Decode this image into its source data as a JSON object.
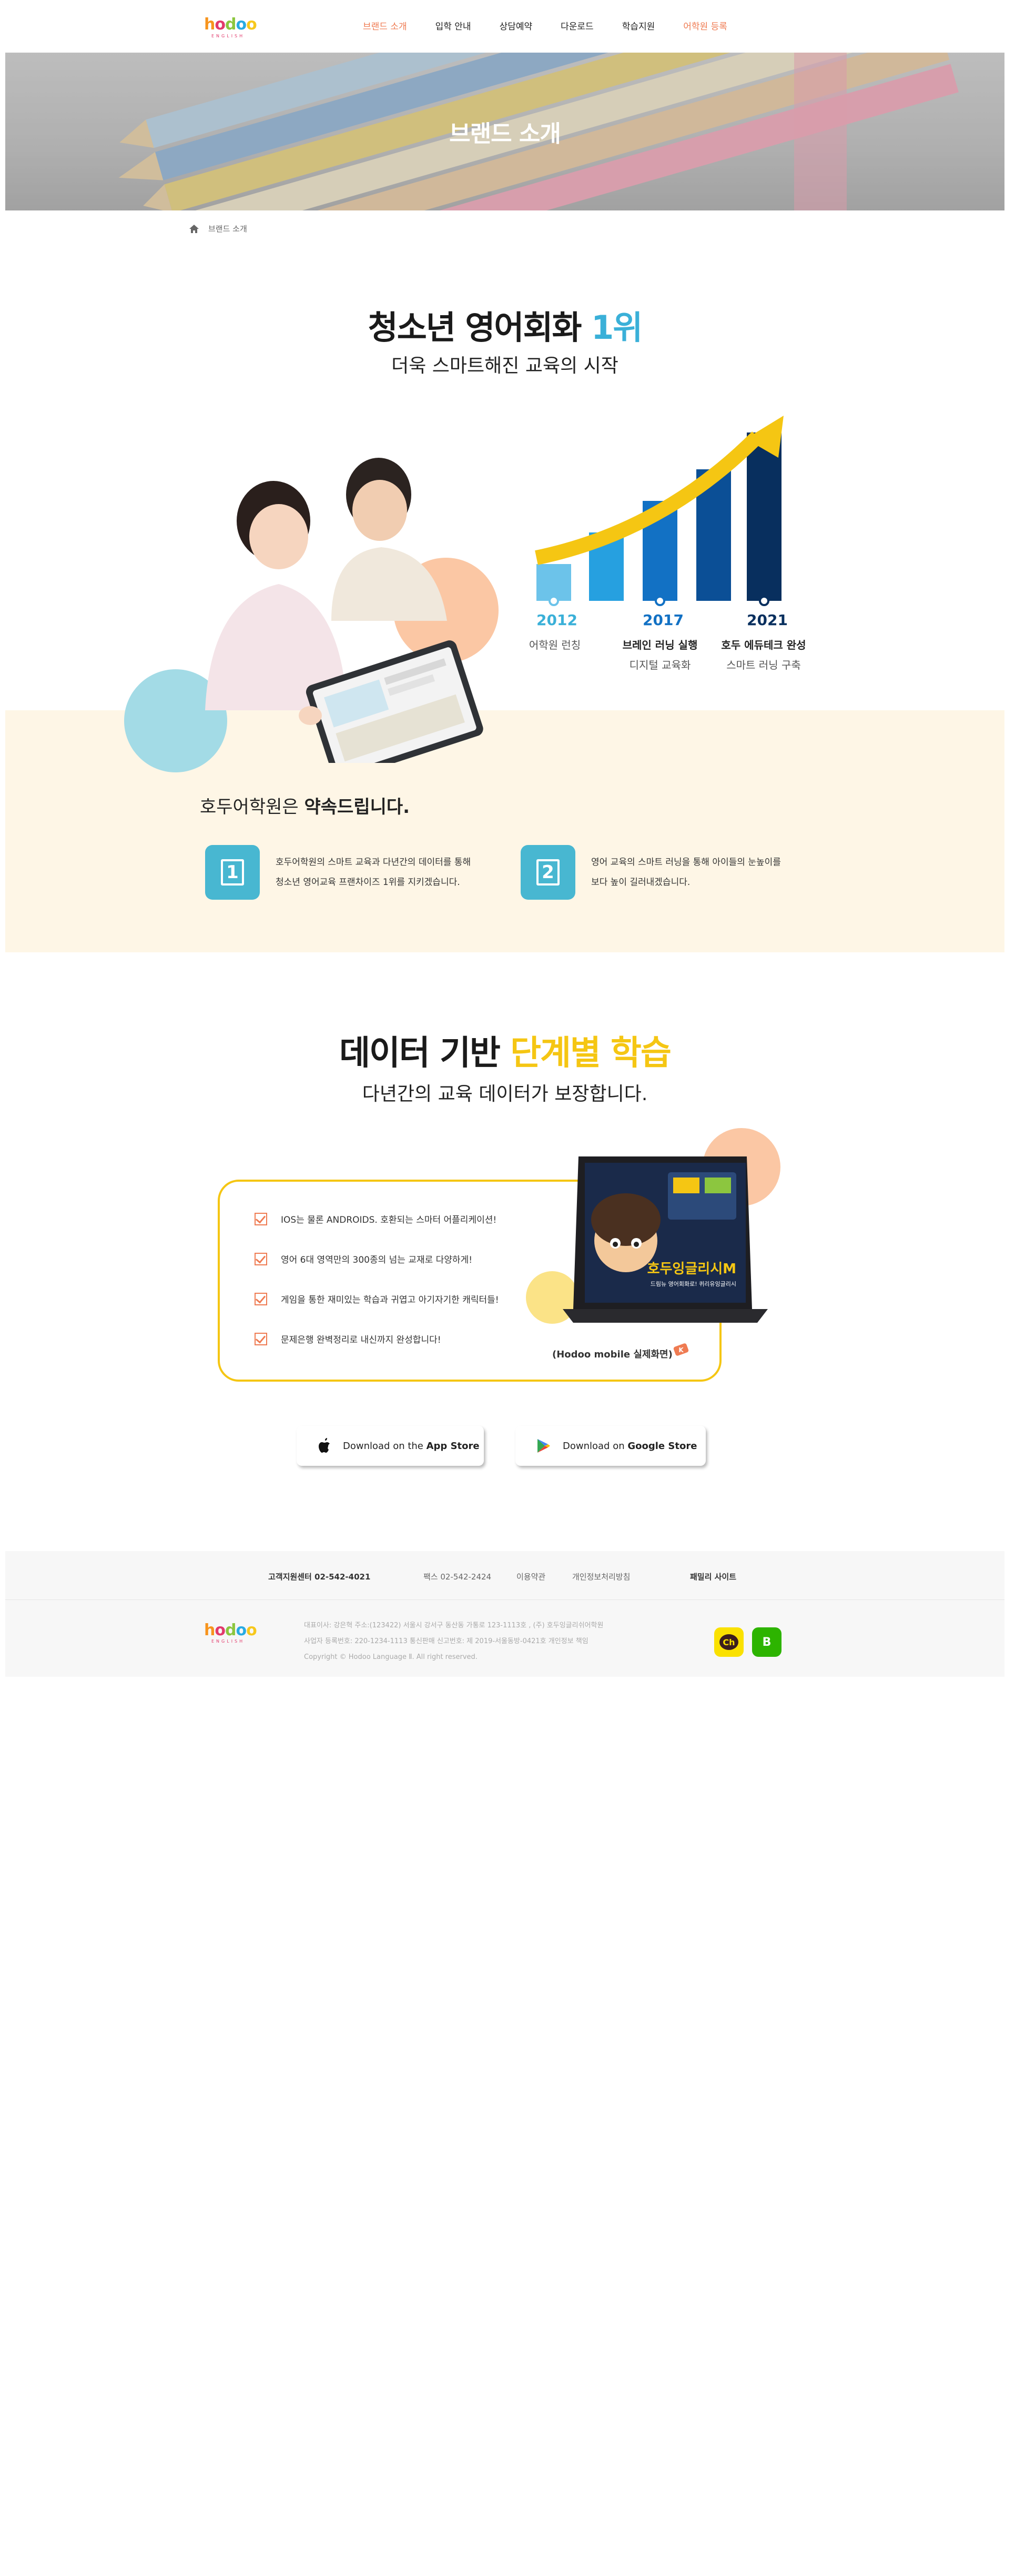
{
  "header": {
    "logo_text": "hodoo",
    "logo_sub": "ENGLISH",
    "nav": [
      {
        "label": "브랜드 소개"
      },
      {
        "label": "입학 안내"
      },
      {
        "label": "상담예약"
      },
      {
        "label": "다운로드"
      },
      {
        "label": "학습지원"
      },
      {
        "label": "어학원 등록"
      }
    ]
  },
  "hero": {
    "title": "브랜드 소개"
  },
  "breadcrumb": {
    "current": "브랜드 소개"
  },
  "intro": {
    "title_main": "청소년 영어회화 ",
    "title_highlight": "1위",
    "subtitle": "더욱 스마트해진 교육의 시작"
  },
  "timeline": [
    {
      "year": "2012",
      "title": "",
      "desc": "어학원 런칭"
    },
    {
      "year": "2017",
      "title": "브레인 러닝 실행",
      "desc": "디지털 교육화"
    },
    {
      "year": "2021",
      "title": "호두 에듀테크 완성",
      "desc": "스마트 러닝 구축"
    }
  ],
  "promise": {
    "prefix": "호두어학원은 ",
    "bold": "약속드립니다.",
    "items": [
      {
        "num": "1",
        "line1": "호두어학원의 스마트 교육과 다년간의 데이터를 통해",
        "line2": "청소년 영어교육 프랜차이즈 1위를 지키겠습니다."
      },
      {
        "num": "2",
        "line1": "영어 교육의 스마트 러닝을 통해 아이들의 눈높이를",
        "line2": "보다 높이 길러내겠습니다."
      }
    ]
  },
  "data_section": {
    "title_main": "데이터 기반 ",
    "title_highlight": "단계별 학습",
    "subtitle": "다년간의 교육 데이터가 보장합니다.",
    "features": [
      "IOS는 물론 ANDROIDS. 호환되는 스마터 어플리케이션!",
      "영어 6대 영역만의 300종의 넘는 교재로 다양하게!",
      "게임을 통한 재미있는 학습과 귀엽고 아기자기한 캐릭터들!",
      "문제은행 완벽정리로 내신까지 완성합니다!"
    ],
    "mobile_label": "(Hodoo mobile 실제화면)",
    "tablet_title": "호두잉글리시M",
    "tablet_sub": "드림뉴 영어회화로! 퀴리유잉글리시"
  },
  "stores": [
    {
      "prefix": "Download on the ",
      "bold": "App Store"
    },
    {
      "prefix": "Download on ",
      "bold": "Google Store"
    }
  ],
  "footer": {
    "cs": "고객지원센터 02-542-4021",
    "fax": "팩스 02-542-2424",
    "terms": "이용약관",
    "privacy": "개인정보처리방침",
    "family": "패밀리 사이트",
    "info1": "대표이사: 강은혁 주소:(123422) 서울시 강서구 동산동 가통로 123-1113호 , (주) 호두잉글리쉬어학원",
    "info2": "사업자 등록번호: 220-1234-1113 통신판매 신고번호: 제 2019-서울동방-0421호 개인정보 책임",
    "info3": "Copyright © Hodoo Language Ⅱ. All right reserved.",
    "sns": [
      "Ch",
      "B"
    ]
  },
  "colors": {
    "accent_orange": "#ef7b52",
    "accent_blue": "#3ab0d8",
    "accent_yellow": "#f5c613",
    "peach_bg": "#fef6e6",
    "kakao": "#fae100",
    "blog_green": "#2db400"
  }
}
